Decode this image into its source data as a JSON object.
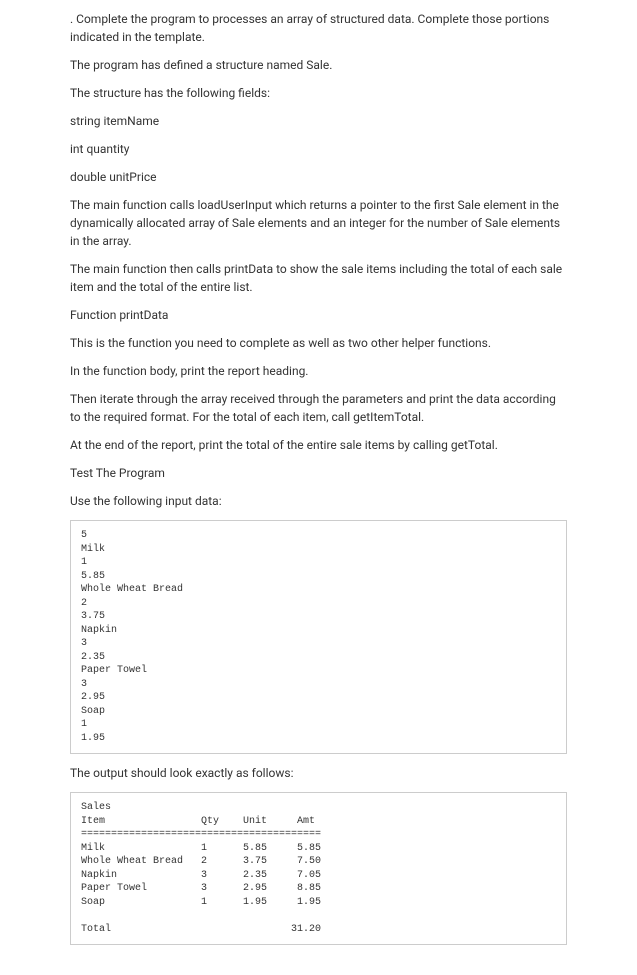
{
  "paragraphs": {
    "p1": ". Complete the program to processes an array of structured data. Complete those portions indicated in the template.",
    "p2": "The program has defined a structure named Sale.",
    "p3": "The structure has the following fields:",
    "p4": "string itemName",
    "p5": "int quantity",
    "p6": "double unitPrice",
    "p7": "The main function calls loadUserInput which returns a pointer to the first Sale element in the dynamically allocated array of Sale elements and an integer for the number of Sale elements in the array.",
    "p8": "The main function then calls printData to show the sale items including the total of each sale item and the total of the entire list.",
    "p9": "Function printData",
    "p10": "This is the function you need to complete as well as two other helper functions.",
    "p11": "In the function body, print the report heading.",
    "p12": "Then iterate through the array received through the parameters and print the data according to the required format. For the total of each item, call getItemTotal.",
    "p13": "At the end of the report, print the total of the entire sale items by calling getTotal.",
    "p14": "Test The Program",
    "p15": "Use the following input data:",
    "p16": "The output should look exactly as follows:"
  },
  "input_block": "5\nMilk\n1\n5.85\nWhole Wheat Bread\n2\n3.75\nNapkin\n3\n2.35\nPaper Towel\n3\n2.95\nSoap\n1\n1.95",
  "output_block": "Sales\nItem                Qty    Unit     Amt\n========================================\nMilk                1      5.85     5.85\nWhole Wheat Bread   2      3.75     7.50\nNapkin              3      2.35     7.05\nPaper Towel         3      2.95     8.85\nSoap                1      1.95     1.95\n\nTotal                              31.20"
}
